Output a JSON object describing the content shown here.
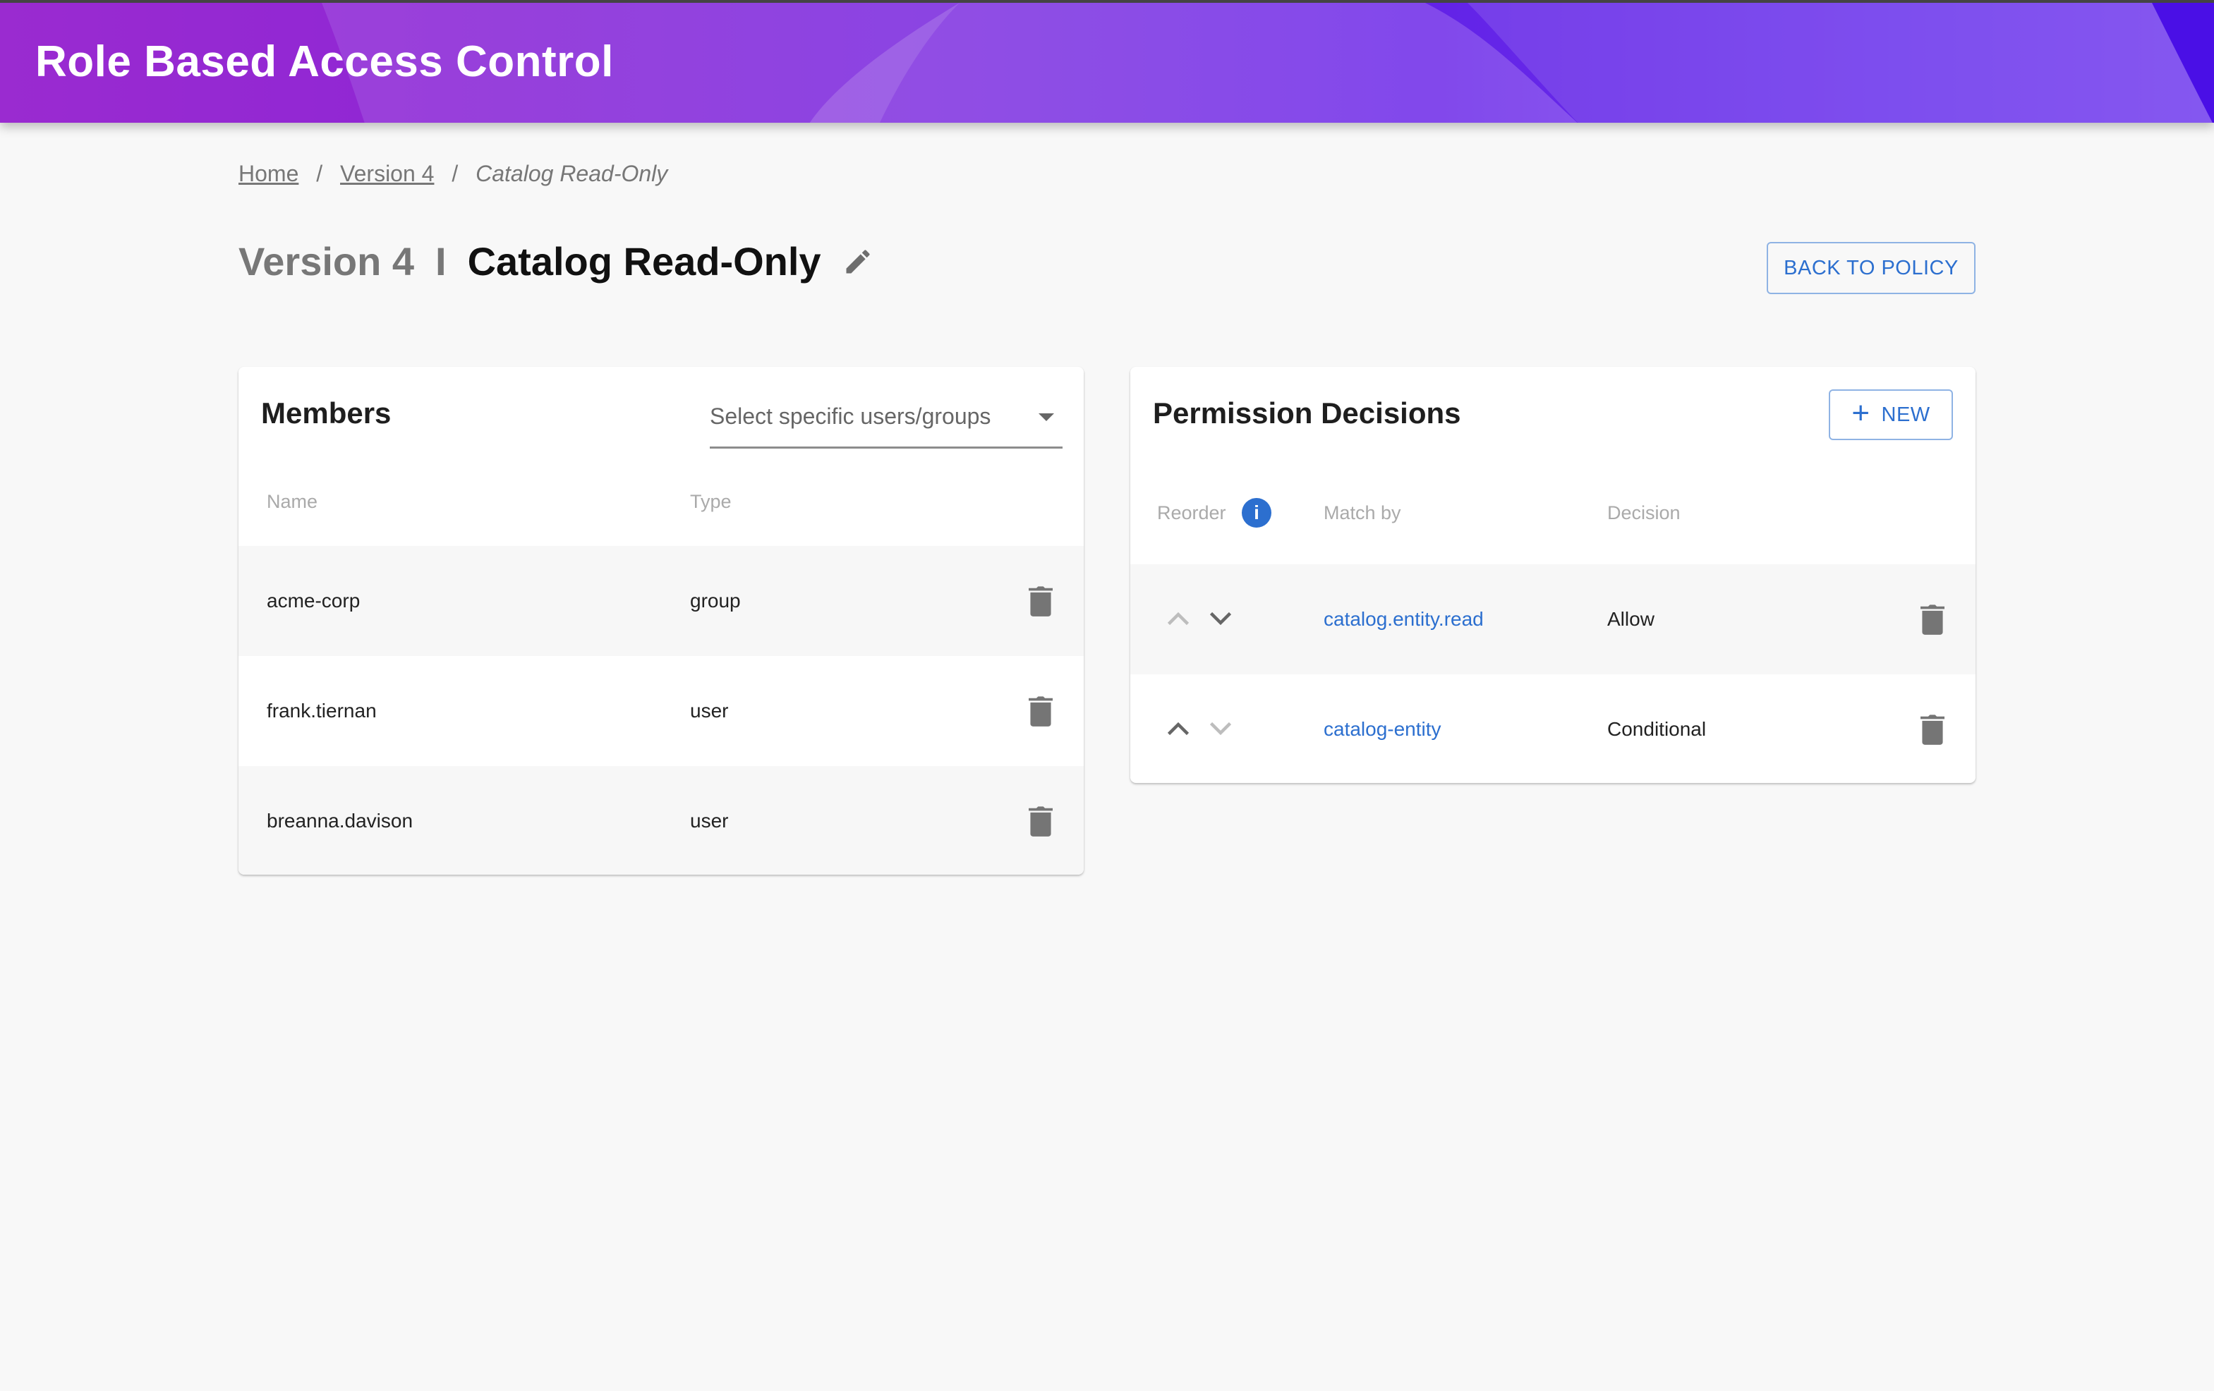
{
  "header": {
    "title": "Role Based Access Control"
  },
  "breadcrumb": {
    "items": [
      {
        "label": "Home"
      },
      {
        "label": "Version 4"
      },
      {
        "label": "Catalog Read-Only"
      }
    ],
    "separator": "/"
  },
  "page": {
    "version": "Version 4",
    "divider": "I",
    "role_name": "Catalog Read-Only",
    "back_button": "BACK TO POLICY"
  },
  "members": {
    "title": "Members",
    "select_placeholder": "Select specific users/groups",
    "columns": {
      "name": "Name",
      "type": "Type"
    },
    "rows": [
      {
        "name": "acme-corp",
        "type": "group"
      },
      {
        "name": "frank.tiernan",
        "type": "user"
      },
      {
        "name": "breanna.davison",
        "type": "user"
      }
    ]
  },
  "permissions": {
    "title": "Permission Decisions",
    "new_button": "NEW",
    "new_icon": "+",
    "columns": {
      "reorder": "Reorder",
      "match_by": "Match by",
      "decision": "Decision"
    },
    "info_icon": "i",
    "rows": [
      {
        "match_by": "catalog.entity.read",
        "decision": "Allow",
        "can_move_up": false,
        "can_move_down": true
      },
      {
        "match_by": "catalog-entity",
        "decision": "Conditional",
        "can_move_up": true,
        "can_move_down": false
      }
    ]
  },
  "colors": {
    "accent": "#2c6fcf",
    "header_start": "#9a2bd0",
    "header_end": "#8a5cf4",
    "background": "#f8f8f8"
  }
}
